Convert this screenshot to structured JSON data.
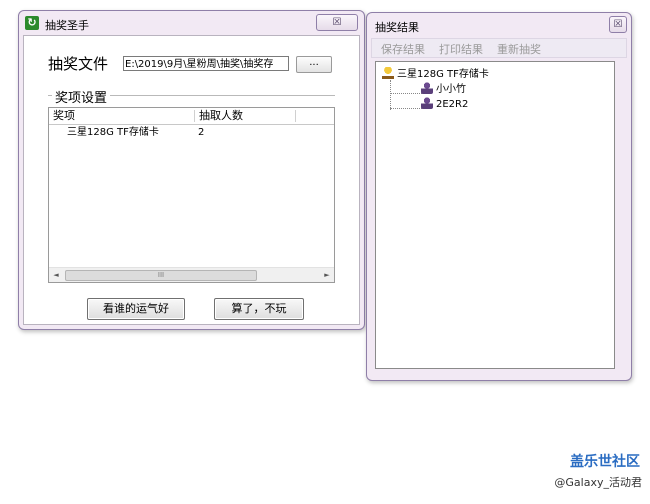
{
  "main_window": {
    "title": "抽奖圣手",
    "close_glyph": "☒",
    "app_icon": "refresh-icon",
    "file_label": "抽奖文件",
    "file_path": "E:\\2019\\9月\\星粉周\\抽奖\\抽奖存",
    "browse_label": "...",
    "group_label": "奖项设置",
    "columns": [
      "奖项",
      "抽取人数"
    ],
    "rows": [
      {
        "prize": "三星128G TF存储卡",
        "count": "2"
      }
    ],
    "scroll_left": "◄",
    "scroll_right": "►",
    "scroll_grip": "III",
    "draw_button": "看谁的运气好",
    "cancel_button": "算了，不玩"
  },
  "result_window": {
    "title": "抽奖结果",
    "close_glyph": "☒",
    "menu": [
      "保存结果",
      "打印结果",
      "重新抽奖"
    ],
    "tree": {
      "root": {
        "icon": "trophy-icon",
        "label": "三星128G TF存储卡"
      },
      "children": [
        {
          "icon": "person-icon",
          "label": "小小竹"
        },
        {
          "icon": "person-icon",
          "label": "2E2R2"
        }
      ]
    }
  },
  "watermark": {
    "brand": "盖乐世社区",
    "handle": "@Galaxy_活动君"
  }
}
